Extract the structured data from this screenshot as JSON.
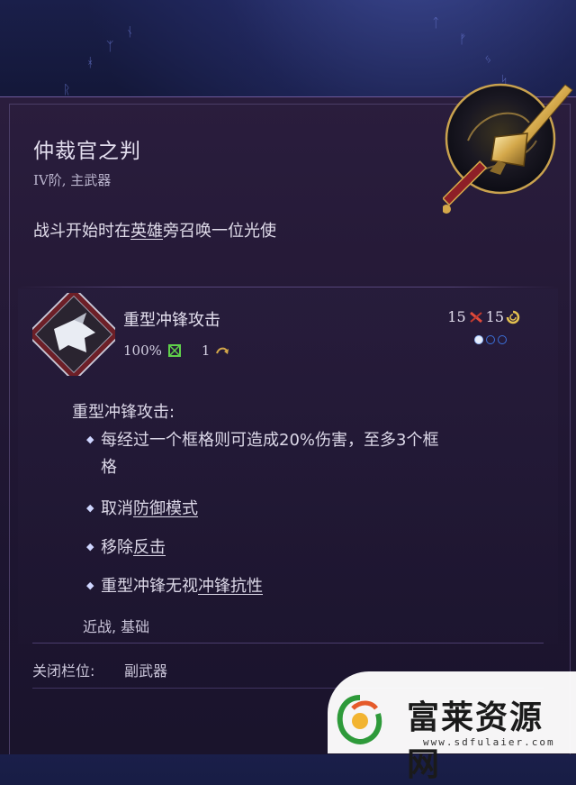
{
  "item": {
    "title": "仲裁官之判",
    "subtitle": "IV阶, 主武器",
    "desc_prefix": "战斗开始时在",
    "desc_link": "英雄",
    "desc_suffix": "旁召唤一位光使"
  },
  "ability": {
    "name": "重型冲锋攻击",
    "accuracy": "100%",
    "turns": "1",
    "cost_a": "15",
    "cost_b": "15",
    "charges_filled": 1,
    "charges_total": 3,
    "detail_title": "重型冲锋攻击:",
    "bullets": {
      "b1_line1": "每经过一个框格则可造成20%伤害，至多3个框",
      "b1_line2": "格",
      "b2_prefix": "取消",
      "b2_link": "防御模式",
      "b3_prefix": "移除",
      "b3_link": "反击",
      "b4_prefix": "重型冲锋无视",
      "b4_link": "冲锋抗性"
    },
    "tags": "近战, 基础"
  },
  "slot": {
    "label": "关闭栏位:",
    "value": "副武器"
  },
  "watermark": {
    "name": "富莱资源网",
    "url": "www.sdfulaier.com"
  },
  "colors": {
    "accent_blue": "#3c6fd8",
    "gold": "#d4a84a",
    "panel_bg": "#241936"
  }
}
